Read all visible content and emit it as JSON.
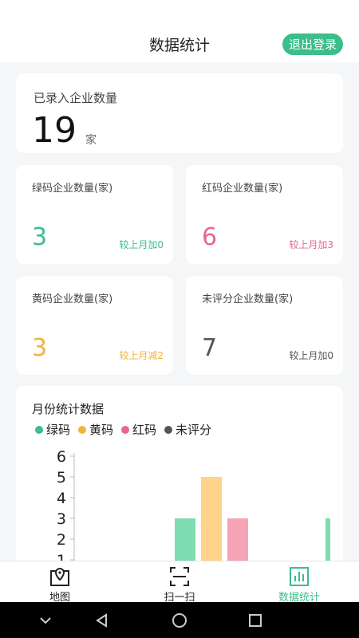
{
  "header": {
    "title": "数据统计",
    "logout_label": "退出登录"
  },
  "total": {
    "label": "已录入企业数量",
    "value": "19",
    "unit": "家"
  },
  "stats": [
    {
      "label": "绿码企业数量(家)",
      "value": "3",
      "change": "较上月加0",
      "color": "#3cbd8a"
    },
    {
      "label": "红码企业数量(家)",
      "value": "6",
      "change": "较上月加3",
      "color": "#e8678a"
    },
    {
      "label": "黄码企业数量(家)",
      "value": "3",
      "change": "较上月减2",
      "color": "#f3b33d"
    },
    {
      "label": "未评分企业数量(家)",
      "value": "7",
      "change": "较上月加0",
      "color": "#555555"
    }
  ],
  "chart_title": "月份统计数据",
  "legend": [
    {
      "name": "绿码",
      "color": "#3cbd8a"
    },
    {
      "name": "黄码",
      "color": "#f3b33d"
    },
    {
      "name": "红码",
      "color": "#e8678a"
    },
    {
      "name": "未评分",
      "color": "#555555"
    }
  ],
  "chart_data": {
    "type": "bar",
    "yticks": [
      "6",
      "5",
      "4",
      "3",
      "2",
      "1"
    ],
    "ylim": [
      0,
      6
    ],
    "series": [
      {
        "name": "绿码",
        "color": "#7fdcb0",
        "values": [
          3,
          3
        ]
      },
      {
        "name": "黄码",
        "color": "#ffd38a",
        "values": [
          5
        ]
      },
      {
        "name": "红码",
        "color": "#f5a3b5",
        "values": [
          3
        ]
      }
    ]
  },
  "bottom_nav": [
    {
      "label": "地图",
      "icon": "map-pin-icon",
      "color": "#222222"
    },
    {
      "label": "扫一扫",
      "icon": "scan-icon",
      "color": "#222222"
    },
    {
      "label": "数据统计",
      "icon": "bar-chart-icon",
      "color": "#3cbd8a"
    }
  ],
  "system_nav": [
    "chevron-down-icon",
    "back-icon",
    "home-icon",
    "recents-icon"
  ]
}
